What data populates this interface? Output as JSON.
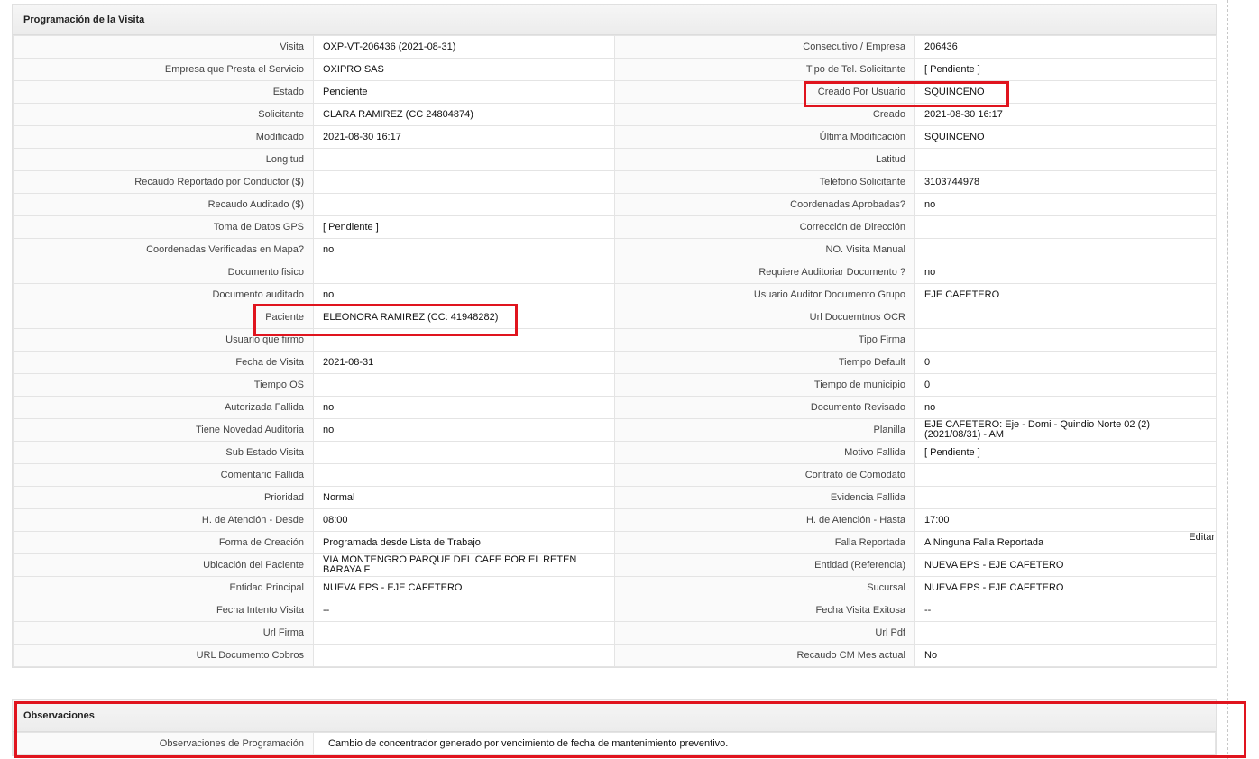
{
  "section_title": "Programación de la Visita",
  "rows": [
    [
      "Visita",
      "OXP-VT-206436 (2021-08-31)",
      "Consecutivo / Empresa",
      "206436"
    ],
    [
      "Empresa que Presta el Servicio",
      "OXIPRO SAS",
      "Tipo de Tel. Solicitante",
      "[ Pendiente ]"
    ],
    [
      "Estado",
      "Pendiente",
      "Creado Por Usuario",
      "SQUINCENO"
    ],
    [
      "Solicitante",
      "CLARA RAMIREZ (CC 24804874)",
      "Creado",
      "2021-08-30 16:17"
    ],
    [
      "Modificado",
      "2021-08-30 16:17",
      "Última Modificación",
      " SQUINCENO"
    ],
    [
      "Longitud",
      "",
      "Latitud",
      ""
    ],
    [
      "Recaudo Reportado por Conductor ($)",
      "",
      "Teléfono Solicitante",
      "3103744978"
    ],
    [
      "Recaudo Auditado ($)",
      "",
      "Coordenadas Aprobadas?",
      " no"
    ],
    [
      "Toma de Datos GPS",
      "[ Pendiente ]",
      "Corrección de Dirección",
      ""
    ],
    [
      "Coordenadas Verificadas en Mapa?",
      " no",
      "NO. Visita Manual",
      ""
    ],
    [
      "Documento fisico",
      "",
      "Requiere Auditoriar Documento ?",
      " no"
    ],
    [
      "Documento auditado",
      " no",
      "Usuario Auditor Documento Grupo",
      "EJE CAFETERO"
    ],
    [
      "Paciente",
      "ELEONORA RAMIREZ (CC: 41948282)",
      "Url Docuemtnos OCR",
      ""
    ],
    [
      "Usuario que firmo",
      "",
      "Tipo Firma",
      ""
    ],
    [
      "Fecha de Visita",
      " 2021-08-31",
      "Tiempo Default",
      "0"
    ],
    [
      "Tiempo OS",
      "",
      "Tiempo de municipio",
      "0"
    ],
    [
      "Autorizada Fallida",
      " no",
      "Documento Revisado",
      " no"
    ],
    [
      "Tiene Novedad Auditoria",
      " no",
      "Planilla",
      "EJE CAFETERO: Eje - Domi - Quindio Norte 02 (2) (2021/08/31) - AM"
    ],
    [
      "Sub Estado Visita",
      "",
      "Motivo Fallida",
      "[ Pendiente ]"
    ],
    [
      "Comentario Fallida",
      "",
      "Contrato de Comodato",
      ""
    ],
    [
      "Prioridad",
      "Normal",
      "Evidencia Fallida",
      ""
    ],
    [
      "H. de Atención - Desde",
      "08:00",
      "H. de Atención - Hasta",
      "17:00"
    ],
    [
      "Forma de Creación",
      "Programada desde Lista de Trabajo",
      "Falla Reportada",
      "A Ninguna Falla Reportada"
    ],
    [
      "Ubicación del Paciente",
      "VIA MONTENGRO PARQUE DEL CAFE POR EL RETEN BARAYA F",
      "Entidad (Referencia)",
      "NUEVA EPS - EJE CAFETERO"
    ],
    [
      "Entidad Principal",
      "NUEVA EPS - EJE CAFETERO",
      "Sucursal",
      "NUEVA EPS - EJE CAFETERO"
    ],
    [
      "Fecha Intento Visita",
      " --",
      "Fecha Visita Exitosa",
      " --"
    ],
    [
      "Url Firma",
      "",
      "Url Pdf",
      ""
    ],
    [
      "URL Documento Cobros",
      "",
      "Recaudo CM Mes actual",
      "No"
    ]
  ],
  "edit_link": "Editar",
  "observaciones": {
    "title": "Observaciones",
    "label": "Observaciones de Programación",
    "value": "Cambio de concentrador generado por vencimiento de fecha de mantenimiento preventivo."
  }
}
